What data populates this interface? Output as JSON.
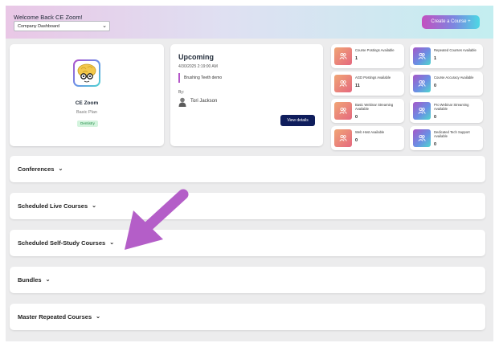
{
  "header": {
    "welcome": "Welcome Back CE Zoom!",
    "dashboard_select": "Company Dashboard",
    "create_course": "Create a Course +"
  },
  "profile": {
    "name": "CE Zoom",
    "plan": "Basic Plan",
    "badge": "Dentistry"
  },
  "upcoming": {
    "title": "Upcoming",
    "datetime": "4/30/2025 2:19:00 AM",
    "course": "Brushing Teeth demo",
    "by_label": "By:",
    "presenter": "Tori Jackson",
    "view_details": "View details"
  },
  "stats": [
    {
      "label": "Course Postings Available",
      "value": "1"
    },
    {
      "label": "Repeated Courses Available",
      "value": "1"
    },
    {
      "label": "AGD Postings Available",
      "value": "11"
    },
    {
      "label": "Course Accuracy Available",
      "value": "0"
    },
    {
      "label": "Basic Webinar Streaming Available",
      "value": "0"
    },
    {
      "label": "Pro Webinar Streaming Available",
      "value": "0"
    },
    {
      "label": "Web Host Available",
      "value": "0"
    },
    {
      "label": "Dedicated Tech Support Available",
      "value": "0"
    }
  ],
  "sections": [
    {
      "label": "Conferences"
    },
    {
      "label": "Scheduled Live Courses"
    },
    {
      "label": "Scheduled Self-Study Courses"
    },
    {
      "label": "Bundles"
    },
    {
      "label": "Master Repeated Courses"
    }
  ],
  "colors": {
    "accent_purple": "#b456c9",
    "navy_button": "#0f1d5c",
    "arrow": "#b45ec8",
    "badge_green": "#1d8a43"
  }
}
